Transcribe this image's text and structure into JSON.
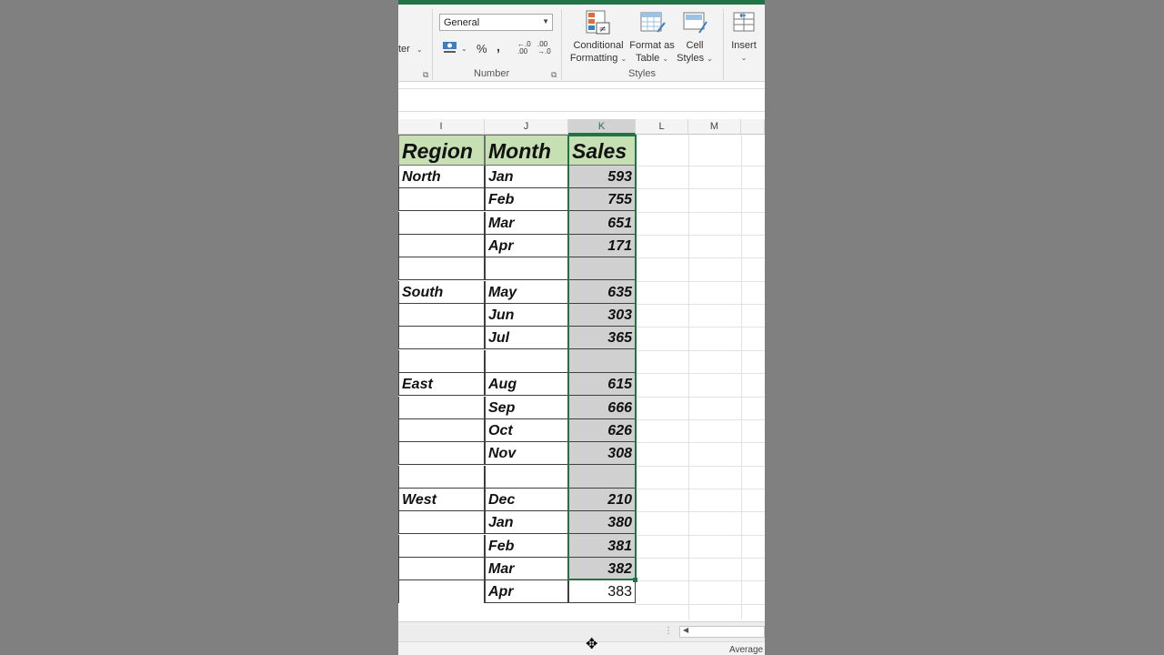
{
  "ribbon": {
    "alignment_partial_label": "ter",
    "number_format": "General",
    "number_group_label": "Number",
    "percent_symbol": "%",
    "comma_symbol": ",",
    "inc_decimal_text": "←.0 .00",
    "dec_decimal_text": ".00 →.0",
    "styles_group_label": "Styles",
    "conditional_formatting": {
      "line1": "Conditional",
      "line2": "Formatting"
    },
    "format_as_table": {
      "line1": "Format as",
      "line2": "Table"
    },
    "cell_styles": {
      "line1": "Cell",
      "line2": "Styles"
    },
    "insert": {
      "line1": "Insert"
    }
  },
  "columns": [
    "I",
    "J",
    "K",
    "L",
    "M"
  ],
  "selected_column": "K",
  "table": {
    "headers": [
      "Region",
      "Month",
      "Sales"
    ],
    "rows": [
      [
        "North",
        "Jan",
        "593"
      ],
      [
        "",
        "Feb",
        "755"
      ],
      [
        "",
        "Mar",
        "651"
      ],
      [
        "",
        "Apr",
        "171"
      ],
      [
        "",
        "",
        ""
      ],
      [
        "South",
        "May",
        "635"
      ],
      [
        "",
        "Jun",
        "303"
      ],
      [
        "",
        "Jul",
        "365"
      ],
      [
        "",
        "",
        ""
      ],
      [
        "East",
        "Aug",
        "615"
      ],
      [
        "",
        "Sep",
        "666"
      ],
      [
        "",
        "Oct",
        "626"
      ],
      [
        "",
        "Nov",
        "308"
      ],
      [
        "",
        "",
        ""
      ],
      [
        "West",
        "Dec",
        "210"
      ],
      [
        "",
        "Jan",
        "380"
      ],
      [
        "",
        "Feb",
        "381"
      ],
      [
        "",
        "Mar",
        "382"
      ]
    ],
    "extra_row": [
      "",
      "Apr",
      "383"
    ]
  },
  "status": {
    "summary_label": "Average"
  },
  "colors": {
    "header_fill": "#c6e0b4",
    "selection_fill": "#d0d0d0",
    "selection_border": "#217346",
    "excel_green": "#217346"
  }
}
